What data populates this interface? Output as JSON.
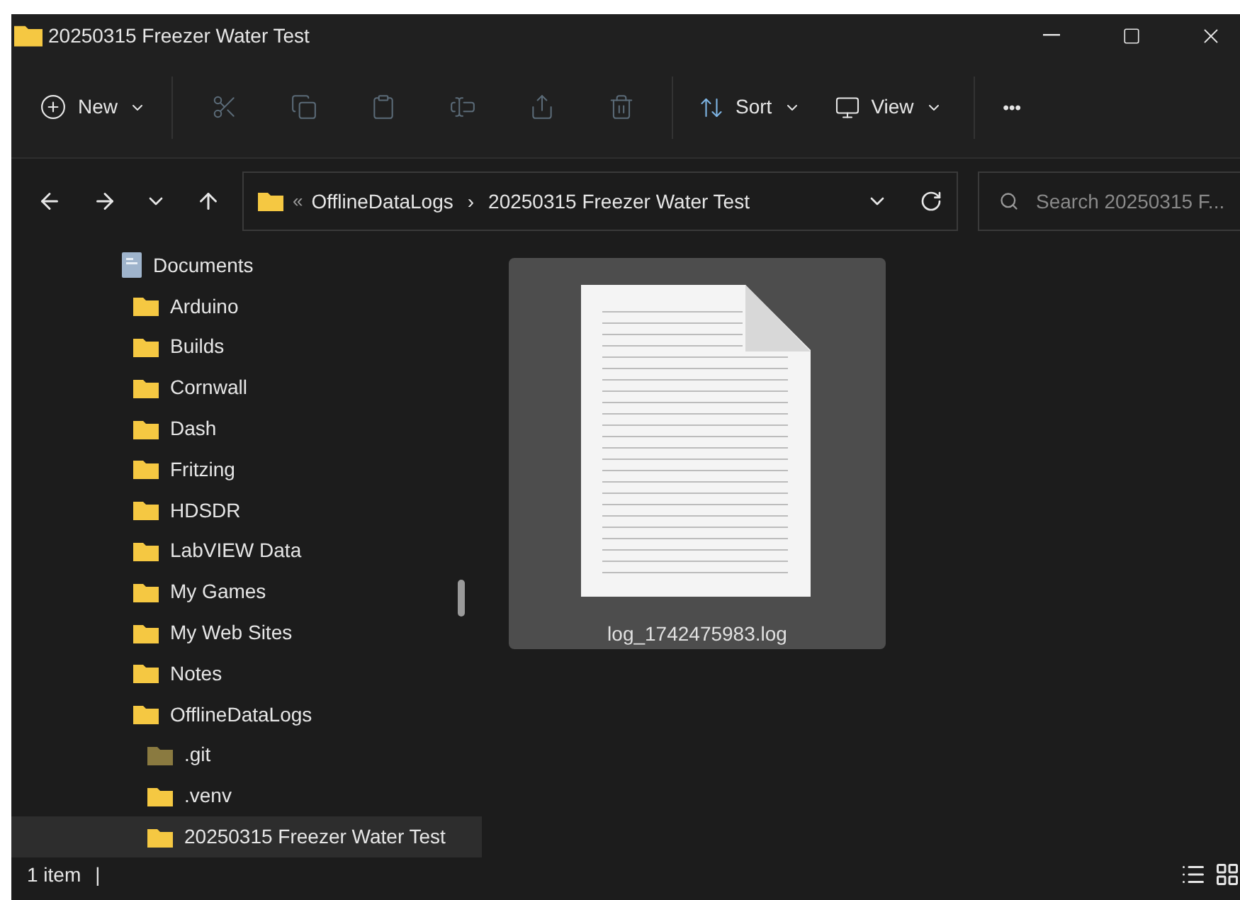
{
  "window": {
    "title": "20250315 Freezer Water Test"
  },
  "toolbar": {
    "new_label": "New",
    "actions": [
      {
        "kind": "cut",
        "disabled": true
      },
      {
        "kind": "copy",
        "disabled": true
      },
      {
        "kind": "paste",
        "disabled": true
      },
      {
        "kind": "rename",
        "disabled": true
      },
      {
        "kind": "share",
        "disabled": true
      },
      {
        "kind": "delete",
        "disabled": true
      }
    ],
    "sort_label": "Sort",
    "view_label": "View",
    "more_label": "•••"
  },
  "address": {
    "overflow": "«",
    "crumbs": [
      "OfflineDataLogs",
      "20250315 Freezer Water Test"
    ],
    "separator": "›"
  },
  "search": {
    "placeholder": "Search 20250315 F..."
  },
  "sidebar": {
    "items": [
      {
        "label": "Documents",
        "kind": "library",
        "selected": false,
        "children": [
          {
            "label": "Arduino",
            "kind": "folder",
            "selected": false
          },
          {
            "label": "Builds",
            "kind": "folder",
            "selected": false
          },
          {
            "label": "Cornwall",
            "kind": "folder",
            "selected": false
          },
          {
            "label": "Dash",
            "kind": "folder",
            "selected": false
          },
          {
            "label": "Fritzing",
            "kind": "folder",
            "selected": false
          },
          {
            "label": "HDSDR",
            "kind": "folder",
            "selected": false
          },
          {
            "label": "LabVIEW Data",
            "kind": "folder",
            "selected": false
          },
          {
            "label": "My Games",
            "kind": "folder",
            "selected": false
          },
          {
            "label": "My Web Sites",
            "kind": "folder",
            "selected": false
          },
          {
            "label": "Notes",
            "kind": "folder",
            "selected": false
          },
          {
            "label": "OfflineDataLogs",
            "kind": "folder",
            "selected": false,
            "children": [
              {
                "label": ".git",
                "kind": "hidden",
                "selected": false
              },
              {
                "label": ".venv",
                "kind": "folder",
                "selected": false
              },
              {
                "label": "20250315 Freezer Water Test",
                "kind": "folder",
                "selected": true
              }
            ]
          }
        ]
      }
    ]
  },
  "files": [
    {
      "name": "log_1742475983.log",
      "selected": true
    }
  ],
  "status_bar": {
    "count": "1 item",
    "separator": "|"
  }
}
